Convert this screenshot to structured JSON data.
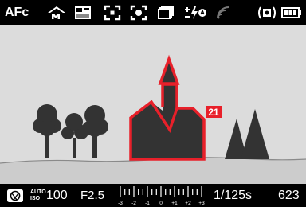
{
  "top_bar": {
    "focus_mode": "AFc",
    "icons": [
      "scene-mode-icon",
      "film-mode-icon",
      "af-field-icon",
      "metering-icon",
      "drive-mode-icon",
      "flash-exposure-comp-icon",
      "wifi-icon",
      "stabilization-icon",
      "battery-icon"
    ]
  },
  "viewfinder": {
    "focus_frame_label": "21",
    "accent_color": "#e8202a"
  },
  "bottom_bar": {
    "mode_icon": "aperture-priority-icon",
    "iso_top": "AUTO",
    "iso_bottom": "ISO",
    "iso_value": "100",
    "aperture": "F2.5",
    "ev_scale_labels": [
      "-3",
      "-2",
      "-1",
      "0",
      "+1",
      "+2",
      "+3"
    ],
    "shutter_speed": "1/125s",
    "shots_remaining": "623"
  }
}
